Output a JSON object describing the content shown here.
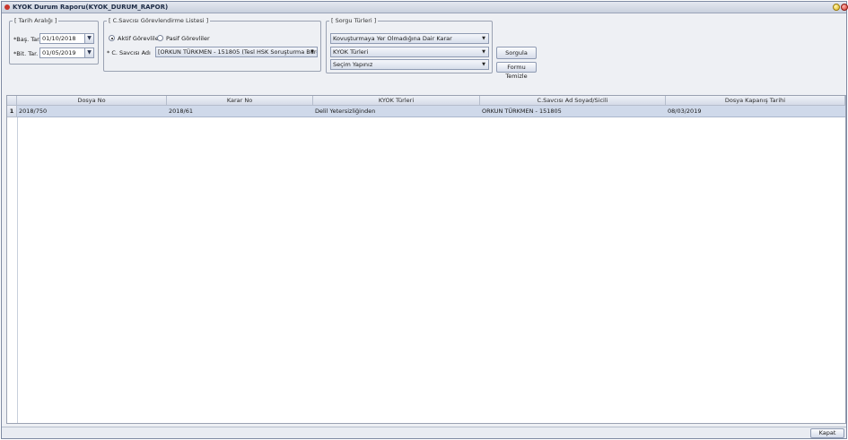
{
  "window": {
    "title": "KYOK Durum Raporu(KYOK_DURUM_RAPOR)"
  },
  "date_group": {
    "legend": "[ Tarih Aralığı ]",
    "start_label": "*Baş. Tar.",
    "start_value": "01/10/2018",
    "end_label": "*Bit. Tar.",
    "end_value": "01/05/2019"
  },
  "prosecutor_group": {
    "legend": "[ C.Savcısı Görevlendirme Listesi ]",
    "active_label": "Aktif Görevliler",
    "passive_label": "Pasif Görevliler",
    "selected": "active",
    "name_label": "* C. Savcısı Adı",
    "name_value": "[ORKUN TÜRKMEN - 151805 (Tesl HSK Soruşturma Bürosu..."
  },
  "query_group": {
    "legend": "[ Sorgu Türleri ]",
    "type1_value": "Kovuşturmaya Yer Olmadığına Dair Karar",
    "type2_value": "KYOK Türleri",
    "type3_value": "Seçim Yapınız"
  },
  "buttons": {
    "query_label": "Sorgula",
    "clear_label": "Formu Temizle",
    "close_label": "Kapat"
  },
  "table": {
    "columns": [
      "Dosya No",
      "Karar No",
      "KYOK Türleri",
      "C.Savcısı Ad Soyad/Sicili",
      "Dosya Kapanış Tarihi"
    ],
    "rows": [
      {
        "index": "1",
        "cells": [
          "2018/750",
          "2018/61",
          "Delil Yetersizliğinden",
          "ORKUN TÜRKMEN - 151805",
          "08/03/2019"
        ]
      }
    ]
  },
  "icons": {
    "app": "app-icon",
    "dropdown": "chevron-down-icon"
  },
  "colors": {
    "selected_row": "#cfd9ea",
    "header": "#d5dbe8",
    "close_button": "#d2302a",
    "minimize_button": "#e2b316"
  }
}
